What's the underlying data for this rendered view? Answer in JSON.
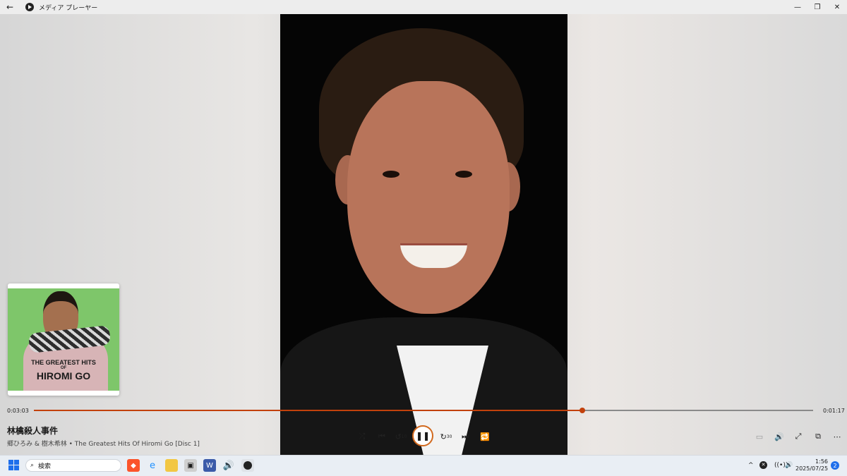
{
  "window": {
    "title": "メディア プレーヤー"
  },
  "player": {
    "elapsed": "0:03:03",
    "remaining": "0:01:17",
    "progress": 0.704,
    "track_title": "林檎殺人事件",
    "track_subtitle": "郷ひろみ & 樹木希林 • The Greatest Hits Of Hiromi Go [Disc 1]"
  },
  "album_art": {
    "line1": "THE GREATEST HITS",
    "line2": "OF",
    "line3": "HIROMI GO"
  },
  "controls": {
    "skip_back_label": "10",
    "skip_forward_label": "30"
  },
  "taskbar": {
    "search_placeholder": "検索",
    "time": "1:56",
    "date": "2025/07/25",
    "notification_count": "2"
  },
  "colors": {
    "accent": "#c2410c"
  }
}
